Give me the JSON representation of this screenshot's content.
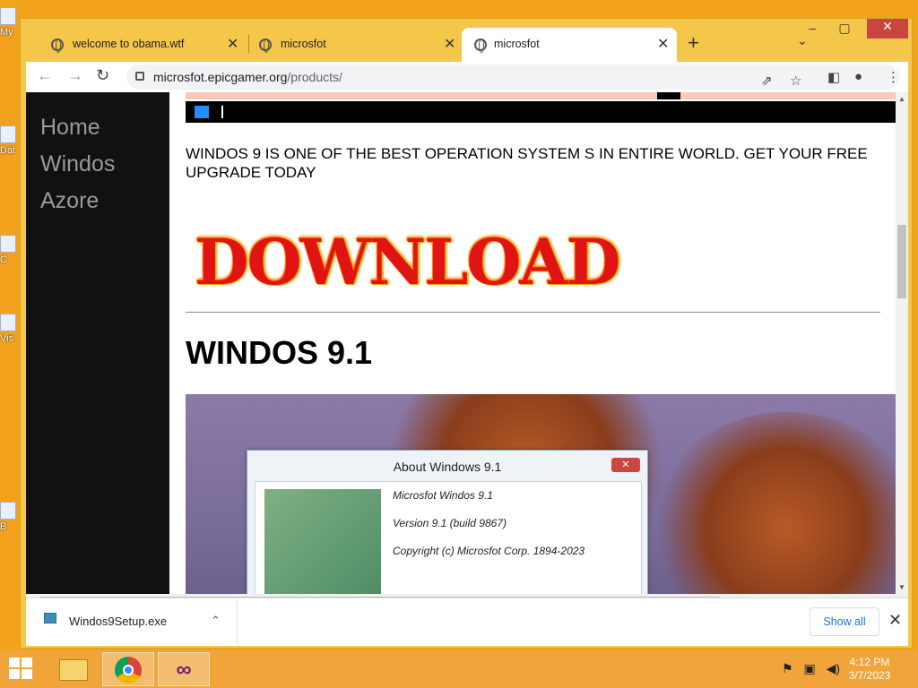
{
  "desktop": {
    "icons": [
      "My",
      "Dat",
      "C",
      "Vis",
      "B"
    ]
  },
  "browser": {
    "tabs": [
      {
        "title": "welcome to obama.wtf",
        "active": false
      },
      {
        "title": "microsfot",
        "active": false
      },
      {
        "title": "microsfot",
        "active": true
      }
    ],
    "new_tab_label": "+",
    "tab_dropdown_label": "⌄",
    "window_controls": {
      "minimize": "–",
      "maximize": "▢",
      "close": "✕"
    },
    "address": {
      "host": "microsfot.epicgamer.org",
      "path": "/products/"
    },
    "toolbar_icons": [
      "back-icon",
      "forward-icon",
      "reload-icon",
      "share-icon",
      "bookmark-star-icon",
      "side-panel-icon",
      "profile-icon",
      "menu-icon"
    ]
  },
  "page": {
    "nav": [
      "Home",
      "Windos",
      "Azore"
    ],
    "promo_text": "WINDOS 9 IS ONE OF THE BEST OPERATION SYSTEM S IN ENTIRE WORLD. GET YOUR FREE UPGRADE TODAY",
    "download_label": "DOWNLOAD",
    "heading": "WINDOS 9.1",
    "about_dialog": {
      "title": "About Windows 9.1",
      "close_label": "✕",
      "lines": [
        "Microsfot Windos 9.1",
        "Version 9.1 (build 9867)",
        "Copyright (c) Microsfot Corp. 1894-2023"
      ]
    }
  },
  "downloads": {
    "file_name": "Windos9Setup.exe",
    "show_all_label": "Show all",
    "close_label": "✕"
  },
  "taskbar": {
    "apps": [
      "file-explorer-icon",
      "chrome-icon",
      "visual-studio-icon"
    ],
    "clock_time": "4:12 PM",
    "clock_date": "3/7/2023"
  },
  "colors": {
    "desktop": "#f3a21d",
    "taskbar": "#f0a43a",
    "window_frame": "#f4c64a",
    "sidebar": "#111111",
    "download_red": "#e01414",
    "close_red": "#c7463f"
  }
}
